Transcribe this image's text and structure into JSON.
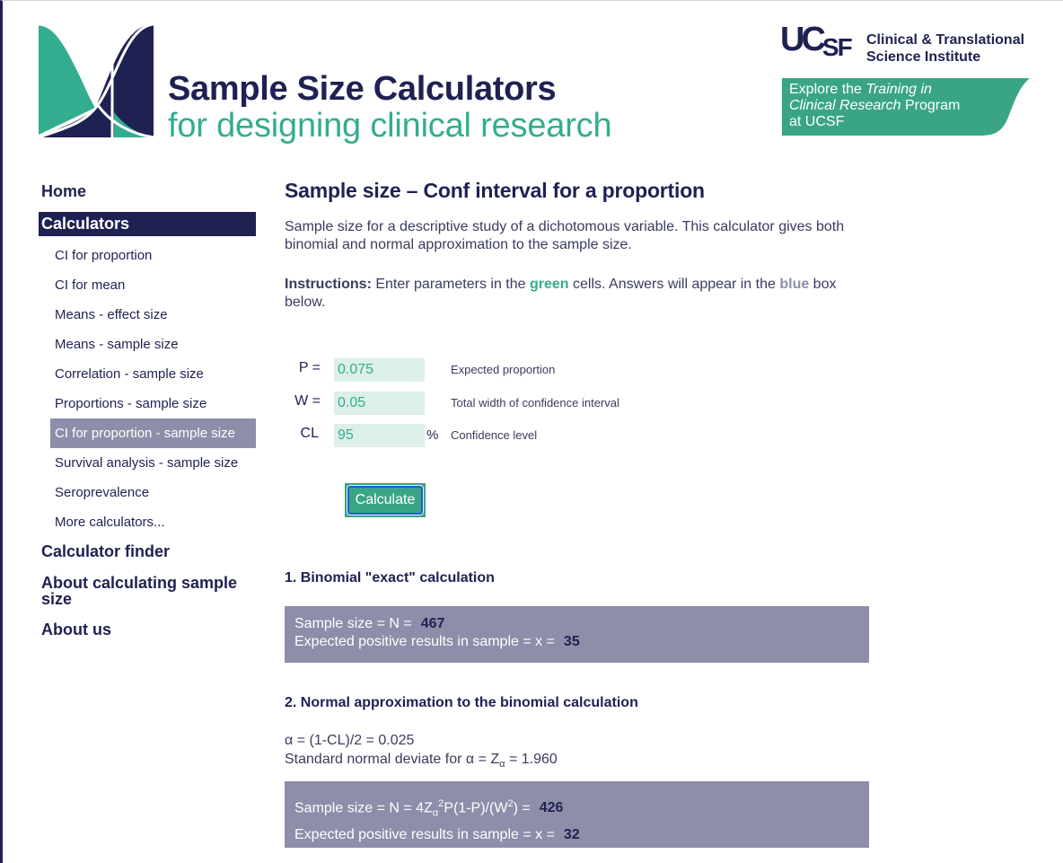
{
  "header": {
    "title": "Sample Size Calculators",
    "subtitle": "for designing clinical research",
    "logo_icon": "overlapping-bell-curves-logo",
    "colors": {
      "navy": "#1f2152",
      "green": "#33ad8f",
      "result_box": "#8d8ea9",
      "input_bg": "#dcefe8"
    }
  },
  "ucsf": {
    "wordmark_uc": "UC",
    "wordmark_sf": "SF",
    "institute_line1": "Clinical & Translational",
    "institute_line2": "Science Institute",
    "banner": {
      "part1": "Explore the ",
      "part2_italic": "Training in",
      "part3_italic": "Clinical Research",
      "part4": " Program",
      "part5": "at UCSF"
    }
  },
  "sidebar": {
    "home": "Home",
    "calculators": "Calculators",
    "sub_items": [
      {
        "label": "CI for proportion",
        "active": false
      },
      {
        "label": "CI for mean",
        "active": false
      },
      {
        "label": "Means - effect size",
        "active": false
      },
      {
        "label": "Means - sample size",
        "active": false
      },
      {
        "label": "Correlation - sample size",
        "active": false
      },
      {
        "label": "Proportions - sample size",
        "active": false
      },
      {
        "label": "CI for proportion - sample size",
        "active": true
      },
      {
        "label": "Survival analysis - sample size",
        "active": false
      },
      {
        "label": "Seroprevalence",
        "active": false
      },
      {
        "label": "More calculators...",
        "active": false
      }
    ],
    "calculator_finder": "Calculator finder",
    "about_sample_size": "About calculating sample size",
    "about_us": "About us"
  },
  "main": {
    "title": "Sample size – Conf interval for a proportion",
    "description": "Sample size for a descriptive study of a dichotomous variable. This calculator gives both binomial and normal approximation to the sample size.",
    "instructions": {
      "label": "Instructions:",
      "text1": " Enter parameters in the ",
      "green_word": "green",
      "text2": " cells. Answers will appear in the ",
      "blue_word": "blue",
      "text3": " box below."
    },
    "params": [
      {
        "label": "P =",
        "value": "0.075",
        "unit": "",
        "description": "Expected proportion"
      },
      {
        "label": "W =",
        "value": "0.05",
        "unit": "",
        "description": "Total width of confidence interval"
      },
      {
        "label": "CL",
        "value": "95",
        "unit": "%",
        "description": "Confidence level"
      }
    ],
    "calculate_label": "Calculate",
    "section1": {
      "heading": "1. Binomial \"exact\" calculation",
      "line1_label": "Sample size = N =",
      "line1_value": "467",
      "line2_label": "Expected positive results in sample = x =",
      "line2_value": "35"
    },
    "section2": {
      "heading": "2. Normal approximation to the binomial calculation",
      "alpha_line": "α = (1-CL)/2 = 0.025",
      "deviate_prefix": "Standard normal deviate for α = Z",
      "deviate_sub": "α",
      "deviate_suffix": " = 1.960",
      "formula_prefix": "Sample size = N = 4Z",
      "formula_sub": "α",
      "formula_sup": "2",
      "formula_mid": "P(1-P)/(W",
      "formula_sup2": "2",
      "formula_end": ") =",
      "line1_value": "426",
      "line2_label": "Expected positive results in sample = x =",
      "line2_value": "32"
    }
  }
}
